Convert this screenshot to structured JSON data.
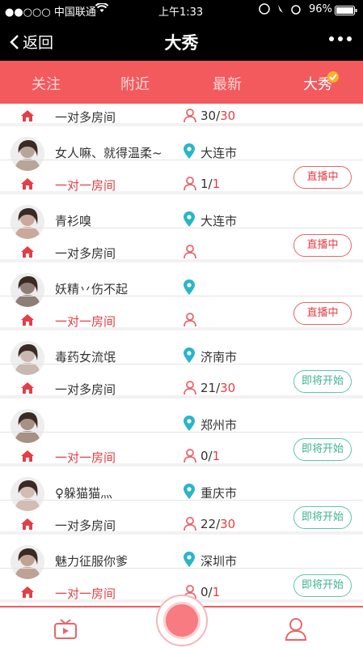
{
  "status_bar": {
    "carrier": "●●○○○ 中国联通",
    "time": "上午1:33",
    "battery": "96%"
  },
  "nav": {
    "back_label": "返回",
    "title": "大秀"
  },
  "tabs": [
    {
      "label": "关注"
    },
    {
      "label": "附近"
    },
    {
      "label": "最新"
    },
    {
      "label": "大秀"
    }
  ],
  "rows": [
    {
      "name": "",
      "city": "",
      "room": "一对多房间",
      "room_red": false,
      "count": "30/",
      "max": "30",
      "status": ""
    },
    {
      "name": "女人嘛、就得温柔~",
      "city": "大连市",
      "room": "一对一房间",
      "room_red": true,
      "count": "1/",
      "max": "1",
      "status": "直播中"
    },
    {
      "name": "青衫嗅",
      "city": "大连市",
      "room": "一对多房间",
      "room_red": false,
      "count": "",
      "max": "",
      "status": "直播中"
    },
    {
      "name": "妖精丷伤不起",
      "city": "",
      "room": "一对一房间",
      "room_red": true,
      "count": "",
      "max": "",
      "status": "直播中"
    },
    {
      "name": "毒药女流氓",
      "city": "济南市",
      "room": "一对多房间",
      "room_red": false,
      "count": "21/",
      "max": "30",
      "status": "即将开始"
    },
    {
      "name": "",
      "city": "郑州市",
      "room": "一对一房间",
      "room_red": true,
      "count": "0/",
      "max": "1",
      "status": "即将开始"
    },
    {
      "name": "♀躲猫猫灬",
      "city": "重庆市",
      "room": "一对多房间",
      "room_red": false,
      "count": "22/",
      "max": "30",
      "status": "即将开始"
    },
    {
      "name": "魅力征服你爹",
      "city": "深圳市",
      "room": "一对一房间",
      "room_red": true,
      "count": "0/",
      "max": "1",
      "status": "即将开始"
    }
  ],
  "icons": {
    "home": "home-icon",
    "location": "location-pin-icon",
    "person": "person-icon",
    "tv": "tv-icon",
    "profile": "profile-icon"
  },
  "colors": {
    "accent": "#f25a5e",
    "live": "#e53e45",
    "soon": "#3db58a"
  }
}
